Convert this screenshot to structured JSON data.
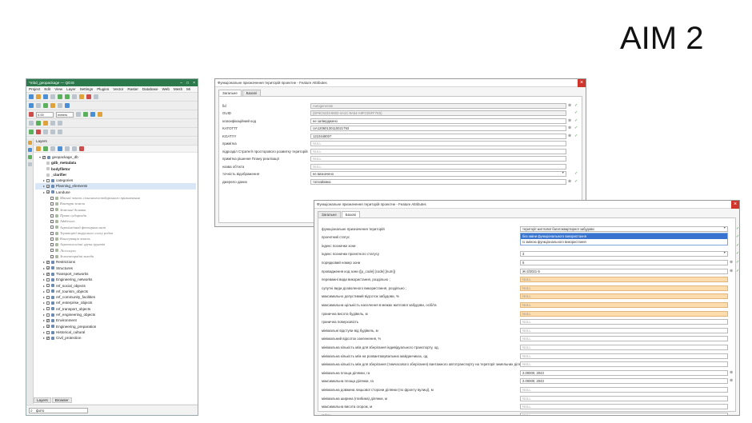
{
  "slide": {
    "title": "AIM 2"
  },
  "qgis": {
    "window_title": "*mbd_geopackage — QGIS",
    "menu": [
      "Project",
      "Edit",
      "View",
      "Layer",
      "Settings",
      "Plugins",
      "Vector",
      "Raster",
      "Database",
      "Web",
      "Mesh",
      "Mi"
    ],
    "scale_value": "0.00",
    "units_value": "meters",
    "layers_panel_title": "Layers",
    "tree": [
      {
        "indent": 1,
        "label": "geopackage_db",
        "cb": true,
        "icon": "grp"
      },
      {
        "indent": 2,
        "label": "gdb_metadata",
        "bold": true,
        "icon": "tb"
      },
      {
        "indent": 2,
        "label": "bodyfiletor",
        "bold": true,
        "icon": "tb"
      },
      {
        "indent": 2,
        "label": "_clarifier",
        "bold": true,
        "icon": "tb"
      },
      {
        "indent": 2,
        "label": "categories",
        "cb": false,
        "icon": "grp",
        "twisty": true
      },
      {
        "indent": 2,
        "label": "Planning_elements",
        "cb": true,
        "icon": "grp",
        "twisty": true,
        "sel": true
      },
      {
        "indent": 2,
        "label": "Landuse",
        "cb": true,
        "icon": "grp",
        "twisty": true
      },
      {
        "indent": 3,
        "label": "Масиві земель сільськогосподарського призначення",
        "italic": true,
        "icon": "lyr"
      },
      {
        "indent": 3,
        "label": "Контури земель",
        "italic": true,
        "icon": "lyr"
      },
      {
        "indent": 3,
        "label": "Земельні ділянки",
        "italic": true,
        "icon": "lyr"
      },
      {
        "indent": 3,
        "label": "Право суборенди",
        "italic": true,
        "icon": "lyr"
      },
      {
        "indent": 3,
        "label": "Addresses",
        "italic": true,
        "icon": "lyr"
      },
      {
        "indent": 3,
        "label": "Агрохімічний фітогранслист",
        "italic": true,
        "icon": "lyr"
      },
      {
        "indent": 3,
        "label": "Територіії тирусного солсу родов",
        "italic": true,
        "icon": "lyr"
      },
      {
        "indent": 3,
        "label": "Консервація земель",
        "italic": true,
        "icon": "lyr"
      },
      {
        "indent": 3,
        "label": "Агроекологічні група ґрунтів",
        "italic": true,
        "icon": "lyr"
      },
      {
        "indent": 3,
        "label": "Лісосмуги",
        "italic": true,
        "icon": "lyr"
      },
      {
        "indent": 3,
        "label": "Землевпорядні заходи",
        "italic": true,
        "icon": "lyr"
      },
      {
        "indent": 2,
        "label": "Restrictions",
        "cb": true,
        "icon": "grp",
        "twisty": true
      },
      {
        "indent": 2,
        "label": "Structures",
        "cb": true,
        "icon": "grp",
        "twisty": true
      },
      {
        "indent": 2,
        "label": "Transport_networks",
        "cb": true,
        "icon": "grp",
        "twisty": true
      },
      {
        "indent": 2,
        "label": "Engineering_networks",
        "cb": false,
        "icon": "grp",
        "twisty": true
      },
      {
        "indent": 2,
        "label": "ref_social_objects",
        "cb": false,
        "icon": "grp",
        "twisty": true
      },
      {
        "indent": 2,
        "label": "ref_tourism_objects",
        "cb": false,
        "icon": "grp",
        "twisty": true
      },
      {
        "indent": 2,
        "label": "ref_community_facilities",
        "cb": false,
        "icon": "grp",
        "twisty": true
      },
      {
        "indent": 2,
        "label": "ref_enterprise_objects",
        "cb": false,
        "icon": "grp",
        "twisty": true
      },
      {
        "indent": 2,
        "label": "ref_transport_objects",
        "cb": false,
        "icon": "grp",
        "twisty": true
      },
      {
        "indent": 2,
        "label": "ref_engineering_objects",
        "cb": false,
        "icon": "grp",
        "twisty": true
      },
      {
        "indent": 2,
        "label": "Environment",
        "cb": true,
        "icon": "grp",
        "twisty": true
      },
      {
        "indent": 2,
        "label": "Engineering_preparation",
        "cb": true,
        "icon": "grp",
        "twisty": true
      },
      {
        "indent": 2,
        "label": "Historical_cultural",
        "cb": false,
        "icon": "grp",
        "twisty": true
      },
      {
        "indent": 2,
        "label": "Civil_protection",
        "cb": true,
        "icon": "grp",
        "twisty": true
      }
    ],
    "bottom_tabs": [
      "Layers",
      "Browser"
    ],
    "search_value": "фото"
  },
  "dialog1": {
    "title": "Функціональне призначення територій проектне - Feature Attributes",
    "tabs": [
      "Загальне",
      "Базові"
    ],
    "rows": [
      {
        "label": "fid",
        "value": "Autogenerate",
        "kind": "readonly",
        "clear": true,
        "ok": true
      },
      {
        "label": "GUID",
        "value": "{DF6C5233-8802-4A1C-9A54-A9FCE5FF7E5}",
        "kind": "readonly",
        "clear": false,
        "ok": true
      },
      {
        "label": "класифікаційний код",
        "value": "не затверджено",
        "kind": "text",
        "clear": true,
        "ok": true
      },
      {
        "label": "KATOTTГ",
        "value": "UA12060130110021793",
        "kind": "text",
        "clear": true,
        "ok": true
      },
      {
        "label": "KOATYY",
        "value": "1210448007",
        "kind": "text",
        "clear": true,
        "ok": true
      },
      {
        "label": "примітка",
        "value": "NULL",
        "kind": "null",
        "clear": false,
        "ok": false
      },
      {
        "label": "підрозділ Стратегії просторового розвитку територій",
        "value": "NULL",
        "kind": "null",
        "clear": false,
        "ok": false
      },
      {
        "label": "примітка рішення Плану реалізації",
        "value": "NULL",
        "kind": "null",
        "clear": false,
        "ok": false
      },
      {
        "label": "назва об'єкта",
        "value": "NULL",
        "kind": "null",
        "clear": false,
        "ok": false
      },
      {
        "label": "точність відображення",
        "value": "не визначено",
        "kind": "combo",
        "clear": false,
        "ok": true
      },
      {
        "label": "джерело даних",
        "value": "топозйомка",
        "kind": "text",
        "clear": true,
        "ok": true
      }
    ]
  },
  "dialog2": {
    "title": "Функціональне призначення територій проектне - Feature Attributes",
    "tabs": [
      "Загальне",
      "Базові"
    ],
    "dropdown_options": [
      "без зміни функціонального використання",
      "Із зміною функціонального використання"
    ],
    "rows": [
      {
        "label": "функціональне призначення територій",
        "value": "території житлової багатоквартирної забудови",
        "kind": "combo",
        "clear": false,
        "ok": true
      },
      {
        "label": "проектний статус",
        "value": "",
        "kind": "none",
        "clear": false,
        "ok": true
      },
      {
        "label": "індекс позначки зони",
        "value": "",
        "kind": "none",
        "clear": false,
        "ok": true
      },
      {
        "label": "індекс позначки проектного статусу",
        "value": "3",
        "kind": "combo",
        "clear": false,
        "ok": true
      },
      {
        "label": "порядковий номер зони",
        "value": "5",
        "kind": "text",
        "clear": true,
        "ok": true
      },
      {
        "label": "провадження код зони ([p_code] [code] [num])",
        "value": "Ж-3/2021-5",
        "kind": "text",
        "clear": true,
        "ok": true
      },
      {
        "label": "переважні види використання, роздільно ;",
        "value": "NULL",
        "kind": "orange",
        "clear": false,
        "ok": false
      },
      {
        "label": "супутні види дозволеного використання, роздільно ;",
        "value": "NULL",
        "kind": "orange",
        "clear": false,
        "ok": false
      },
      {
        "label": "максимально допустимий відсоток забудови, %",
        "value": "NULL",
        "kind": "orange",
        "clear": false,
        "ok": false
      },
      {
        "label": "максимальна щільність населення в межах житлової забудови, осіб/га",
        "value": "NULL",
        "kind": "orange",
        "clear": false,
        "ok": false
      },
      {
        "label": "гранична висота будівель, м",
        "value": "NULL",
        "kind": "orange",
        "clear": false,
        "ok": false
      },
      {
        "label": "гранична поверховість",
        "value": "NULL",
        "kind": "null",
        "clear": false,
        "ok": false
      },
      {
        "label": "мінімальні відступи від будівель, м",
        "value": "NULL",
        "kind": "null",
        "clear": false,
        "ok": false
      },
      {
        "label": "мінімальний відсоток озеленення, %",
        "value": "NULL",
        "kind": "null",
        "clear": false,
        "ok": false
      },
      {
        "label": "мінімальна кількість м/м для зберігання індивідуального транспорту, од.",
        "value": "NULL",
        "kind": "null",
        "clear": false,
        "ok": false
      },
      {
        "label": "мінімальна кількість м/м на розвантажувальних майданчиках, од.",
        "value": "NULL",
        "kind": "null",
        "clear": false,
        "ok": false
      },
      {
        "label": "мінімальна кількість м/м для зберігання (тимчасового зберігання) вантажного автотранспорту на території земельних ділянок, од.",
        "value": "NULL",
        "kind": "null",
        "clear": false,
        "ok": false
      },
      {
        "label": "мінімальна площа ділянки, га",
        "value": "2.00000, 2043",
        "kind": "text",
        "clear": true,
        "ok": false
      },
      {
        "label": "максимальна площа ділянки, га",
        "value": "2.00000, 2043",
        "kind": "text",
        "clear": true,
        "ok": false
      },
      {
        "label": "мінімальна довжина лицьової сторони ділянки (по фронту вулиці), м",
        "value": "NULL",
        "kind": "null",
        "clear": false,
        "ok": false
      },
      {
        "label": "мінімальна ширина (глибина) ділянки, м",
        "value": "NULL",
        "kind": "null",
        "clear": false,
        "ok": false
      },
      {
        "label": "максимальна висота огорож, м",
        "value": "NULL",
        "kind": "null",
        "clear": false,
        "ok": false
      },
      {
        "label": "зміни",
        "value": "NULL",
        "kind": "null",
        "clear": false,
        "ok": false
      }
    ]
  }
}
